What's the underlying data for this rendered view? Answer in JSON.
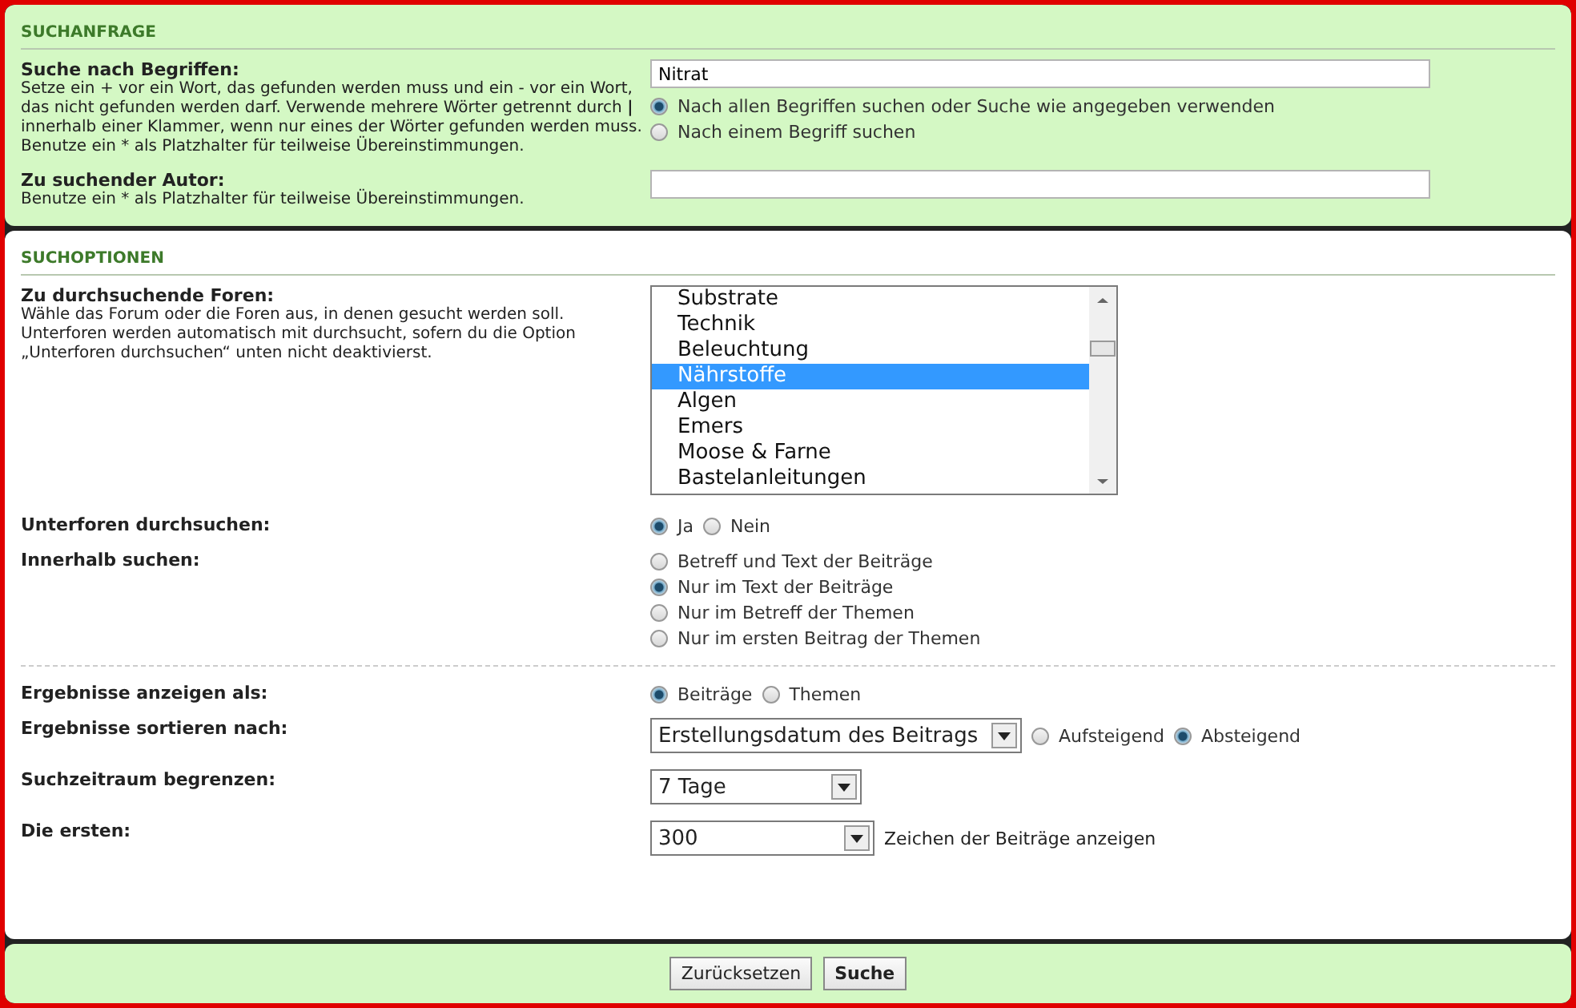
{
  "query": {
    "title": "SUCHANFRAGE",
    "terms": {
      "label": "Suche nach Begriffen:",
      "help": "Setze ein + vor ein Wort, das gefunden werden muss und ein - vor ein Wort, das nicht gefunden werden darf. Verwende mehrere Wörter getrennt durch **|** innerhalb einer Klammer, wenn nur eines der Wörter gefunden werden muss. Benutze ein * als Platzhalter für teilweise Übereinstimmungen.",
      "value": "Nitrat",
      "options": [
        {
          "label": "Nach allen Begriffen suchen oder Suche wie angegeben verwenden",
          "selected": true
        },
        {
          "label": "Nach einem Begriff suchen",
          "selected": false
        }
      ]
    },
    "author": {
      "label": "Zu suchender Autor:",
      "help": "Benutze ein * als Platzhalter für teilweise Übereinstimmungen."
    }
  },
  "options": {
    "title": "SUCHOPTIONEN",
    "forums": {
      "label": "Zu durchsuchende Foren:",
      "help": "Wähle das Forum oder die Foren aus, in denen gesucht werden soll. Unterforen werden automatisch mit durchsucht, sofern du die Option „Unterforen durchsuchen“ unten nicht deaktivierst.",
      "items": [
        {
          "label": "Substrate",
          "selected": false
        },
        {
          "label": "Technik",
          "selected": false
        },
        {
          "label": "Beleuchtung",
          "selected": false
        },
        {
          "label": "Nährstoffe",
          "selected": true
        },
        {
          "label": "Algen",
          "selected": false
        },
        {
          "label": "Emers",
          "selected": false
        },
        {
          "label": "Moose & Farne",
          "selected": false
        },
        {
          "label": "Bastelanleitungen",
          "selected": false
        }
      ]
    },
    "subforums": {
      "label": "Unterforen durchsuchen:",
      "options": [
        {
          "label": "Ja",
          "selected": true
        },
        {
          "label": "Nein",
          "selected": false
        }
      ]
    },
    "within": {
      "label": "Innerhalb suchen:",
      "options": [
        {
          "label": "Betreff und Text der Beiträge",
          "selected": false
        },
        {
          "label": "Nur im Text der Beiträge",
          "selected": true
        },
        {
          "label": "Nur im Betreff der Themen",
          "selected": false
        },
        {
          "label": "Nur im ersten Beitrag der Themen",
          "selected": false
        }
      ]
    },
    "display": {
      "label": "Ergebnisse anzeigen als:",
      "options": [
        {
          "label": "Beiträge",
          "selected": true
        },
        {
          "label": "Themen",
          "selected": false
        }
      ]
    },
    "sort": {
      "label": "Ergebnisse sortieren nach:",
      "value": "Erstellungsdatum des Beitrags",
      "options": [
        {
          "label": "Aufsteigend",
          "selected": false
        },
        {
          "label": "Absteigend",
          "selected": true
        }
      ]
    },
    "timeframe": {
      "label": "Suchzeitraum begrenzen:",
      "value": "7 Tage"
    },
    "first": {
      "label": "Die ersten:",
      "value": "300",
      "suffix": "Zeichen der Beiträge anzeigen"
    }
  },
  "buttons": [
    {
      "label": "Zurücksetzen",
      "primary": false
    },
    {
      "label": "Suche",
      "primary": true
    }
  ]
}
